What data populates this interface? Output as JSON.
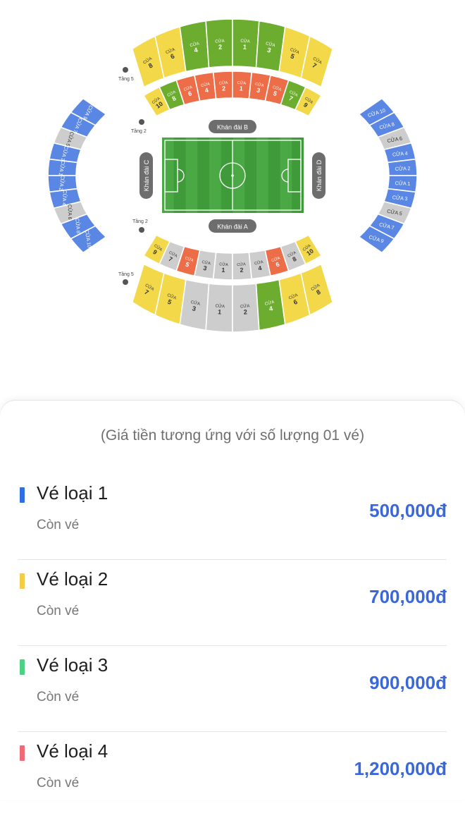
{
  "map": {
    "stand_b": "Khán đài B",
    "stand_a": "Khán đài A",
    "stand_c": "Khán đài C",
    "stand_d": "Khán đài D",
    "level_5": "Tầng 5",
    "level_2": "Tầng 2",
    "gate_word": "CỬA",
    "colors": {
      "blue": "#5a87e3",
      "yellow": "#f3d84a",
      "green": "#6cad2f",
      "orange": "#ec6d47",
      "gray": "#cdcdcd",
      "pitch": "#3f9a3a"
    },
    "gate_numbers": {
      "north_upper": [
        "8",
        "6",
        "4",
        "2",
        "1",
        "3",
        "5",
        "7"
      ],
      "north_lower": [
        "10",
        "8",
        "6",
        "4",
        "2",
        "1",
        "3",
        "5",
        "7",
        "9"
      ],
      "south_lower": [
        "9",
        "7",
        "5",
        "3",
        "1",
        "2",
        "4",
        "6",
        "8",
        "10"
      ],
      "south_upper": [
        "7",
        "5",
        "3",
        "1",
        "2",
        "4",
        "6",
        "8"
      ],
      "west": [
        "9",
        "7",
        "5",
        "3",
        "1",
        "2",
        "4",
        "6",
        "8",
        "10"
      ],
      "east": [
        "10",
        "8",
        "6",
        "4",
        "2",
        "1",
        "3",
        "5",
        "7",
        "9"
      ]
    },
    "sections": {
      "north_upper": [
        "yellow",
        "yellow",
        "green",
        "green",
        "green",
        "green",
        "yellow",
        "yellow"
      ],
      "north_lower": [
        "yellow",
        "green",
        "orange",
        "orange",
        "orange",
        "orange",
        "orange",
        "orange",
        "green",
        "yellow"
      ],
      "south_lower": [
        "yellow",
        "gray",
        "orange",
        "gray",
        "gray",
        "gray",
        "gray",
        "orange",
        "gray",
        "yellow"
      ],
      "south_upper": [
        "yellow",
        "yellow",
        "gray",
        "gray",
        "gray",
        "green",
        "yellow",
        "yellow"
      ],
      "west": [
        "blue",
        "blue",
        "gray",
        "blue",
        "blue",
        "blue",
        "blue",
        "gray",
        "blue",
        "blue"
      ],
      "east": [
        "blue",
        "blue",
        "gray",
        "blue",
        "blue",
        "blue",
        "blue",
        "gray",
        "blue",
        "blue"
      ]
    }
  },
  "price_note": "(Giá tiền tương ứng với số lượng 01 vé)",
  "tickets": [
    {
      "label": "Vé loại 1",
      "status": "Còn vé",
      "price": "500,000đ",
      "color": "#2f6fe4"
    },
    {
      "label": "Vé loại 2",
      "status": "Còn vé",
      "price": "700,000đ",
      "color": "#f4cd45"
    },
    {
      "label": "Vé loại 3",
      "status": "Còn vé",
      "price": "900,000đ",
      "color": "#4fd087"
    },
    {
      "label": "Vé loại 4",
      "status": "Còn vé",
      "price": "1,200,000đ",
      "color": "#ef6b78"
    }
  ]
}
